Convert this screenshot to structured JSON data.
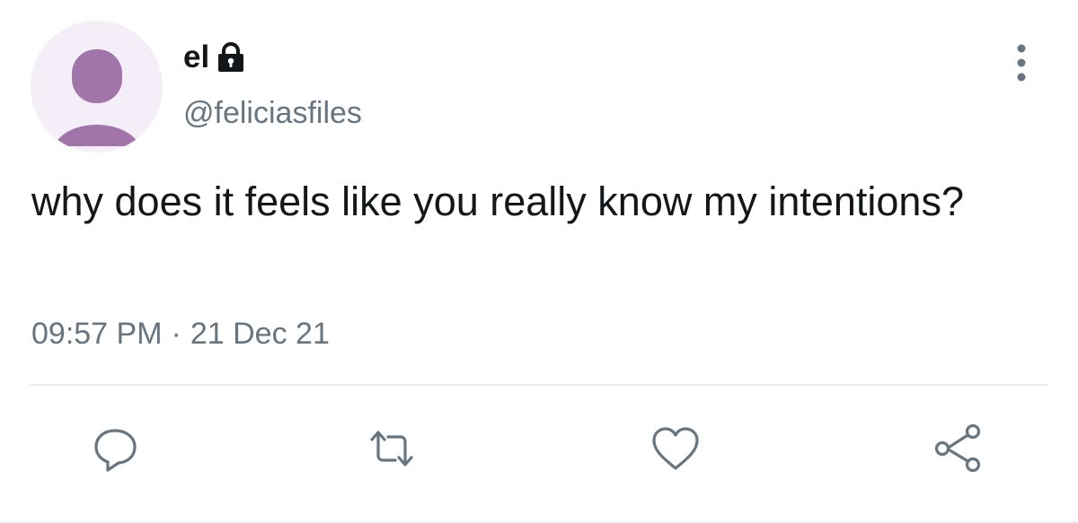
{
  "user": {
    "display_name": "el",
    "handle": "@feliciasfiles",
    "protected": true,
    "avatar": "default-profile-silhouette"
  },
  "tweet": {
    "text": "why does it feels like you really know my intentions?",
    "time": "09:57 PM",
    "separator": "·",
    "date": "21 Dec 21"
  },
  "actions": [
    {
      "name": "reply",
      "icon": "comment-bubble-icon"
    },
    {
      "name": "retweet",
      "icon": "retweet-arrows-icon"
    },
    {
      "name": "like",
      "icon": "heart-icon"
    },
    {
      "name": "share",
      "icon": "share-nodes-icon"
    }
  ],
  "colors": {
    "text_primary": "#14171a",
    "text_secondary": "#66757f",
    "avatar_bg": "#f3eef8",
    "avatar_silhouette": "#a175a9",
    "divider": "#e6ecf0"
  }
}
